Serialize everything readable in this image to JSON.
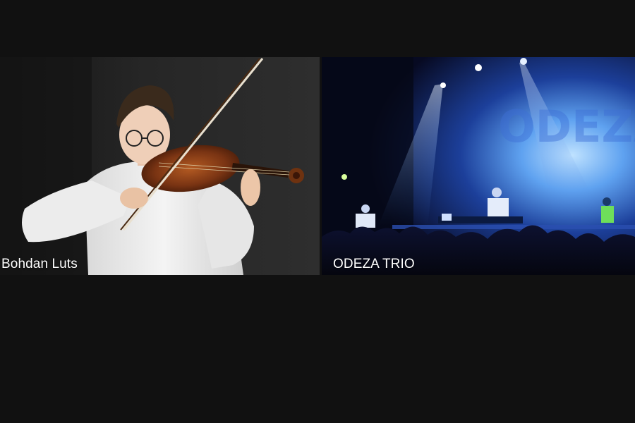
{
  "page": {
    "background": "#111111"
  },
  "artists": [
    {
      "name": "Bohdan Luts",
      "image": "violinist-photo",
      "accent": "#2a2a2a"
    },
    {
      "name": "ODEZA TRIO",
      "image": "concert-stage-photo",
      "accent": "#2f5fd0"
    }
  ]
}
